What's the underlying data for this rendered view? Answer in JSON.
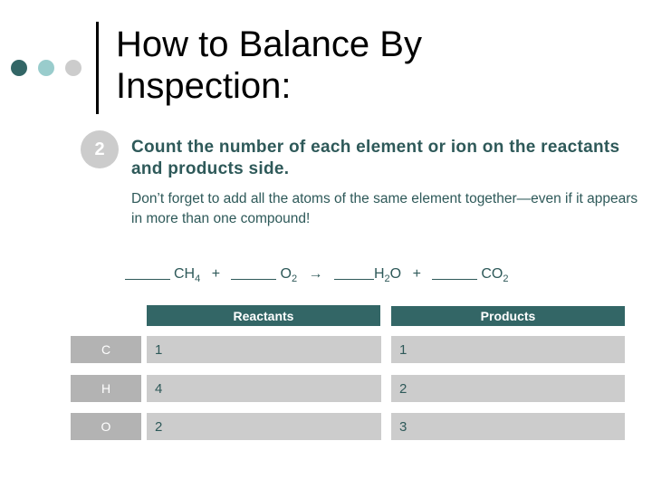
{
  "slide": {
    "title_lines": [
      "How to Balance By",
      "Inspection:"
    ],
    "step": {
      "number": "2",
      "heading": "Count the number of each element or ion on the reactants and products side.",
      "note": "Don’t forget to add all the atoms of the same element together—even if it appears in more than one compound!"
    },
    "equation": {
      "terms": [
        {
          "base": "CH",
          "sub": "4"
        },
        {
          "base": "O",
          "sub": "2"
        },
        {
          "base": "H",
          "sub": "2",
          "tail": "O"
        },
        {
          "base": "CO",
          "sub": "2"
        }
      ],
      "plus": "+",
      "arrow": "→"
    },
    "table": {
      "headers": {
        "reactants": "Reactants",
        "products": "Products"
      },
      "rows": [
        {
          "element": "C",
          "reactants": "1",
          "products": "1"
        },
        {
          "element": "H",
          "reactants": "4",
          "products": "2"
        },
        {
          "element": "O",
          "reactants": "2",
          "products": "3"
        }
      ]
    }
  },
  "colors": {
    "dark_teal": "#336666",
    "light_teal": "#99cccc",
    "gray": "#cccccc",
    "label_gray": "#b3b3b3",
    "text_teal": "#2e5959"
  }
}
